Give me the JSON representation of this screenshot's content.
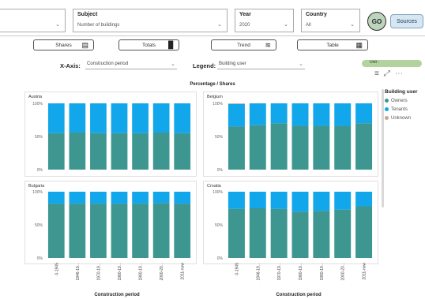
{
  "filters": [
    {
      "label": "",
      "value": ""
    },
    {
      "label": "Subject",
      "value": "Number of buildings"
    },
    {
      "label": "Year",
      "value": "2020"
    },
    {
      "label": "Country",
      "value": "All"
    }
  ],
  "go_label": "GO",
  "sources_label": "Sources",
  "tabs": [
    {
      "label": "Shares",
      "icon": "bar-chart-icon"
    },
    {
      "label": "Totals",
      "icon": "column-chart-icon"
    },
    {
      "label": "Trend",
      "icon": "trend-line-icon"
    },
    {
      "label": "Table",
      "icon": "table-icon"
    }
  ],
  "xaxis_label": "X-Axis:",
  "xaxis_value": "Construction period",
  "legend_label": "Legend:",
  "legend_value": "Building user",
  "unit_label": "Unit -",
  "chart_title": "Percentage / Shares",
  "legend": {
    "title": "Building user",
    "items": [
      {
        "name": "Owners",
        "color": "#3d9690"
      },
      {
        "name": "Tenants",
        "color": "#12a6ea"
      },
      {
        "name": "Unknown",
        "color": "#c9a78f"
      }
    ]
  },
  "chart_data": [
    {
      "type": "bar",
      "title": "Austria",
      "categories": [
        "0-1945",
        "1946-19...",
        "1970-19...",
        "1980-19...",
        "1990-19...",
        "2000-20...",
        "2011-now"
      ],
      "ylim": [
        0,
        100
      ],
      "yticks": [
        "100%",
        "50%",
        "0%"
      ],
      "series": [
        {
          "name": "Owners",
          "values": [
            55,
            56,
            55,
            55,
            55,
            56,
            55
          ]
        },
        {
          "name": "Tenants",
          "values": [
            45,
            44,
            45,
            45,
            45,
            44,
            45
          ]
        },
        {
          "name": "Unknown",
          "values": [
            0,
            0,
            0,
            0,
            0,
            0,
            0
          ]
        }
      ]
    },
    {
      "type": "bar",
      "title": "Belgium",
      "categories": [
        "0-1945",
        "1946-19...",
        "1970-19...",
        "1980-19...",
        "1990-19...",
        "2000-20...",
        "2011-now"
      ],
      "ylim": [
        0,
        100
      ],
      "yticks": [
        "100%",
        "50%",
        "0%"
      ],
      "series": [
        {
          "name": "Owners",
          "values": [
            65,
            67,
            70,
            66,
            66,
            66,
            70
          ]
        },
        {
          "name": "Tenants",
          "values": [
            34,
            33,
            30,
            34,
            34,
            34,
            30
          ]
        },
        {
          "name": "Unknown",
          "values": [
            1,
            0,
            0,
            0,
            0,
            0,
            0
          ]
        }
      ]
    },
    {
      "type": "bar",
      "title": "Bulgaria",
      "categories": [
        "0-1945",
        "1946-19...",
        "1970-19...",
        "1980-19...",
        "1990-19...",
        "2000-20...",
        "2011-now"
      ],
      "ylim": [
        0,
        100
      ],
      "yticks": [
        "100%",
        "50%",
        "0%"
      ],
      "series": [
        {
          "name": "Owners",
          "values": [
            82,
            82,
            82,
            82,
            82,
            83,
            82
          ]
        },
        {
          "name": "Tenants",
          "values": [
            18,
            18,
            18,
            18,
            18,
            17,
            18
          ]
        },
        {
          "name": "Unknown",
          "values": [
            0,
            0,
            0,
            0,
            0,
            0,
            0
          ]
        }
      ]
    },
    {
      "type": "bar",
      "title": "Croatia",
      "categories": [
        "0-1945",
        "1946-19...",
        "1970-19...",
        "1980-19...",
        "1990-19...",
        "2000-20...",
        "2011-now"
      ],
      "ylim": [
        0,
        100
      ],
      "yticks": [
        "100%",
        "50%",
        "0%"
      ],
      "series": [
        {
          "name": "Owners",
          "values": [
            74,
            75,
            74,
            70,
            71,
            73,
            78
          ]
        },
        {
          "name": "Tenants",
          "values": [
            26,
            25,
            26,
            30,
            29,
            27,
            22
          ]
        },
        {
          "name": "Unknown",
          "values": [
            0,
            0,
            0,
            0,
            0,
            0,
            0
          ]
        }
      ]
    }
  ],
  "xaxis_title": "Construction period"
}
